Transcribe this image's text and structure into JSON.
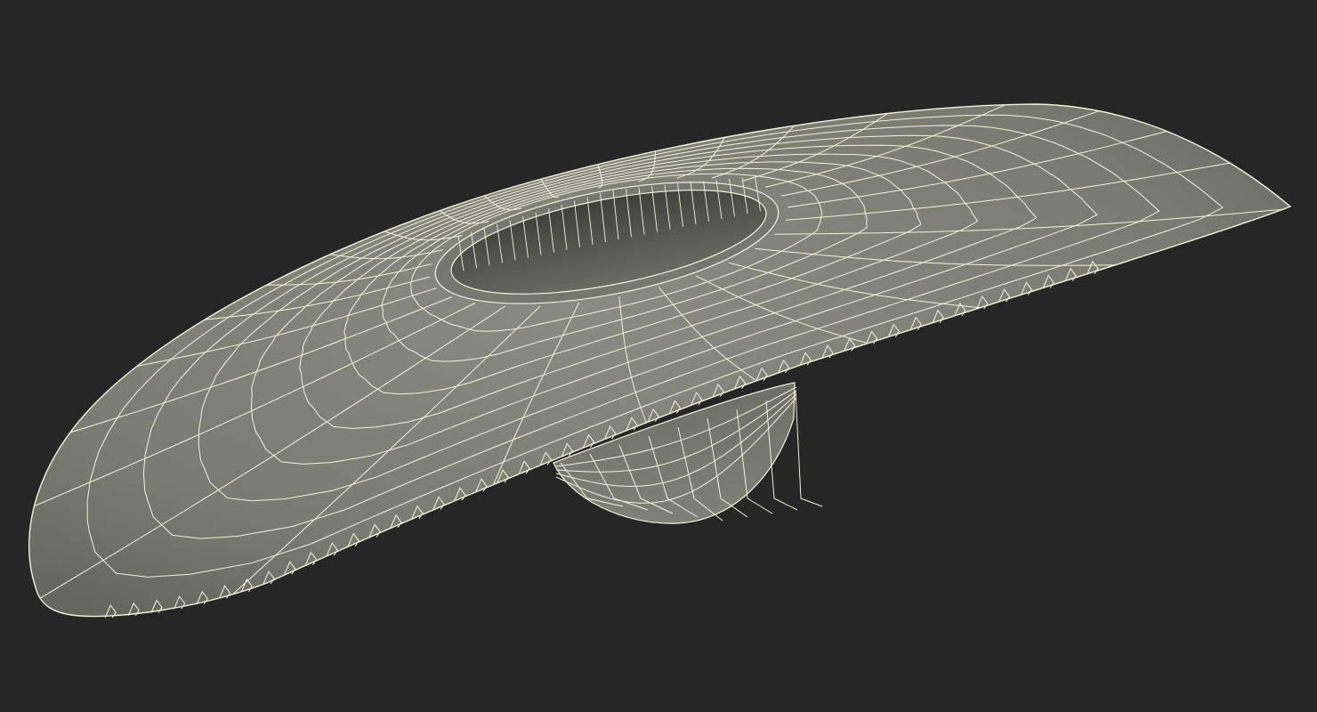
{
  "viewport": {
    "background_color": "#262626",
    "model": {
      "kind": "wireframe-3d-model",
      "surface_color": "#7d7e72",
      "surface_dark_color": "#5c5d55",
      "hole_color": "#4a4b45",
      "wire_color": "#f2f2dc",
      "ring_count": 9,
      "radial_count": 28
    }
  }
}
